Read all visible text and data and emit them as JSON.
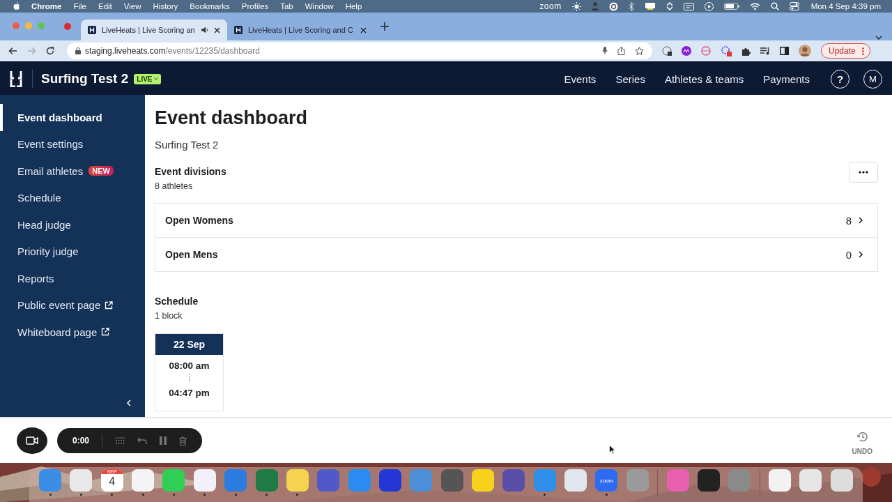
{
  "menu_bar": {
    "app": "Chrome",
    "items": [
      "File",
      "Edit",
      "View",
      "History",
      "Bookmarks",
      "Profiles",
      "Tab",
      "Window",
      "Help"
    ],
    "zoom_label": "zoom",
    "clock": "Mon 4 Sep  4:39 pm"
  },
  "browser": {
    "tabs": [
      {
        "title": "LiveHeats | Live Scoring an",
        "selected": true,
        "audio": true
      },
      {
        "title": "LiveHeats | Live Scoring and C",
        "selected": false,
        "audio": false
      }
    ],
    "host": "staging.liveheats.com",
    "path": "/events/12235/dashboard",
    "update_button": "Update"
  },
  "app_header": {
    "title": "Surfing Test 2",
    "status_badge": "LIVE",
    "nav": [
      "Events",
      "Series",
      "Athletes & teams",
      "Payments"
    ],
    "help": "?",
    "avatar": "M"
  },
  "sidebar": {
    "items": [
      {
        "label": "Event dashboard",
        "selected": true
      },
      {
        "label": "Event settings",
        "selected": false
      },
      {
        "label": "Email athletes",
        "selected": false,
        "badge": "NEW"
      },
      {
        "label": "Schedule",
        "selected": false
      },
      {
        "label": "Head judge",
        "selected": false
      },
      {
        "label": "Priority judge",
        "selected": false
      },
      {
        "label": "Reports",
        "selected": false
      },
      {
        "label": "Public event page",
        "selected": false,
        "external": true
      },
      {
        "label": "Whiteboard page",
        "selected": false,
        "external": true
      }
    ]
  },
  "main": {
    "title": "Event dashboard",
    "subtitle": "Surfing Test 2",
    "divisions": {
      "heading": "Event divisions",
      "count": "8 athletes",
      "rows": [
        {
          "name": "Open Womens",
          "athletes": "8"
        },
        {
          "name": "Open Mens",
          "athletes": "0"
        }
      ]
    },
    "schedule": {
      "heading": "Schedule",
      "count": "1 block",
      "blocks": [
        {
          "date": "22 Sep",
          "start": "08:00 am",
          "end": "04:47 pm"
        }
      ]
    }
  },
  "recorder": {
    "timer": "0:00",
    "undo": "UNDO"
  },
  "dock": [
    {
      "kind": "app",
      "color": "#3a8ee6",
      "running": true
    },
    {
      "kind": "app",
      "color": "#e8e8e8",
      "running": true
    },
    {
      "kind": "calendar",
      "month": "SEP",
      "day": "4",
      "running": true
    },
    {
      "kind": "app",
      "color": "#f4f4f4",
      "running": true
    },
    {
      "kind": "app",
      "color": "#2fcf56",
      "running": true
    },
    {
      "kind": "app",
      "color": "#f2f0f8",
      "running": true
    },
    {
      "kind": "app",
      "color": "#2b7be0",
      "running": true
    },
    {
      "kind": "app",
      "color": "#1f7a44",
      "running": true
    },
    {
      "kind": "app",
      "color": "#f5d34f",
      "running": true
    },
    {
      "kind": "app",
      "color": "#5059c9",
      "running": false
    },
    {
      "kind": "app",
      "color": "#2a8cf0",
      "running": false
    },
    {
      "kind": "app",
      "color": "#2436d6",
      "running": false
    },
    {
      "kind": "app",
      "color": "#4b8fd9",
      "running": false
    },
    {
      "kind": "app",
      "color": "#555555",
      "running": false
    },
    {
      "kind": "app",
      "color": "#f7d21c",
      "running": false
    },
    {
      "kind": "app",
      "color": "#5a4fa8",
      "running": false
    },
    {
      "kind": "app",
      "color": "#2f8fe8",
      "running": true
    },
    {
      "kind": "app",
      "color": "#dfe6ee",
      "running": false
    },
    {
      "kind": "zoom",
      "label": "zoom",
      "running": true
    },
    {
      "kind": "app",
      "color": "#9a9a9a",
      "running": false
    },
    {
      "kind": "separator"
    },
    {
      "kind": "app",
      "color": "#e85fb0",
      "running": false
    },
    {
      "kind": "app",
      "color": "#222222",
      "running": false
    },
    {
      "kind": "app",
      "color": "#8a8a8a",
      "running": false
    },
    {
      "kind": "separator"
    },
    {
      "kind": "app",
      "color": "#f2f2f2",
      "running": false
    },
    {
      "kind": "app",
      "color": "#e6e6e6",
      "running": false
    },
    {
      "kind": "app",
      "color": "#dddddd",
      "running": false
    }
  ]
}
